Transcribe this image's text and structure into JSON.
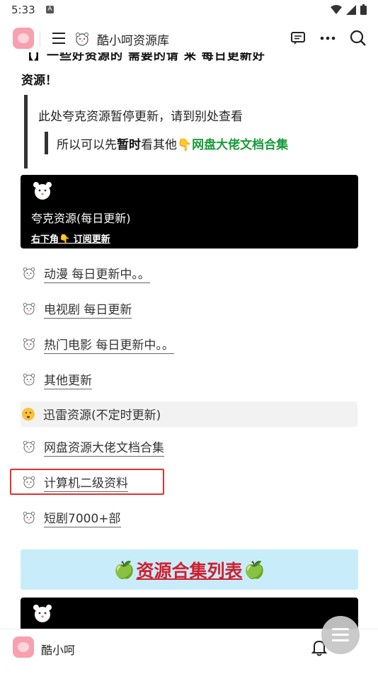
{
  "status": {
    "time": "5:33",
    "a_label": "A"
  },
  "topbar": {
    "title": "酷小呵资源库"
  },
  "content": {
    "head_partial": "【】一些好资源的 需要的请 来 每日更新好",
    "head_line2": "资源！",
    "quote_main": "此处夸克资源暂停更新，请到别处查看",
    "quote_sub": {
      "prefix": "所以可以先",
      "bold": "暂时",
      "middle": "看其他👇",
      "link": "网盘大佬文档合集"
    },
    "card1": {
      "title": "夸克资源(每日更新)",
      "link": "右下角👇 订阅更新"
    },
    "items": [
      {
        "label": "动漫 每日更新中。。"
      },
      {
        "label": "电视剧 每日更新"
      },
      {
        "label": "热门电影 每日更新中。。"
      },
      {
        "label": "其他更新"
      },
      {
        "label": "迅雷资源(不定时更新)"
      },
      {
        "label": "网盘资源大佬文档合集"
      },
      {
        "label": "计算机二级资料"
      },
      {
        "label": "短剧7000+部"
      }
    ],
    "banner": {
      "apple_left": "🍏",
      "title": "资源合集列表",
      "apple_right": "🍏"
    }
  },
  "bottombar": {
    "name": "酷小呵"
  }
}
